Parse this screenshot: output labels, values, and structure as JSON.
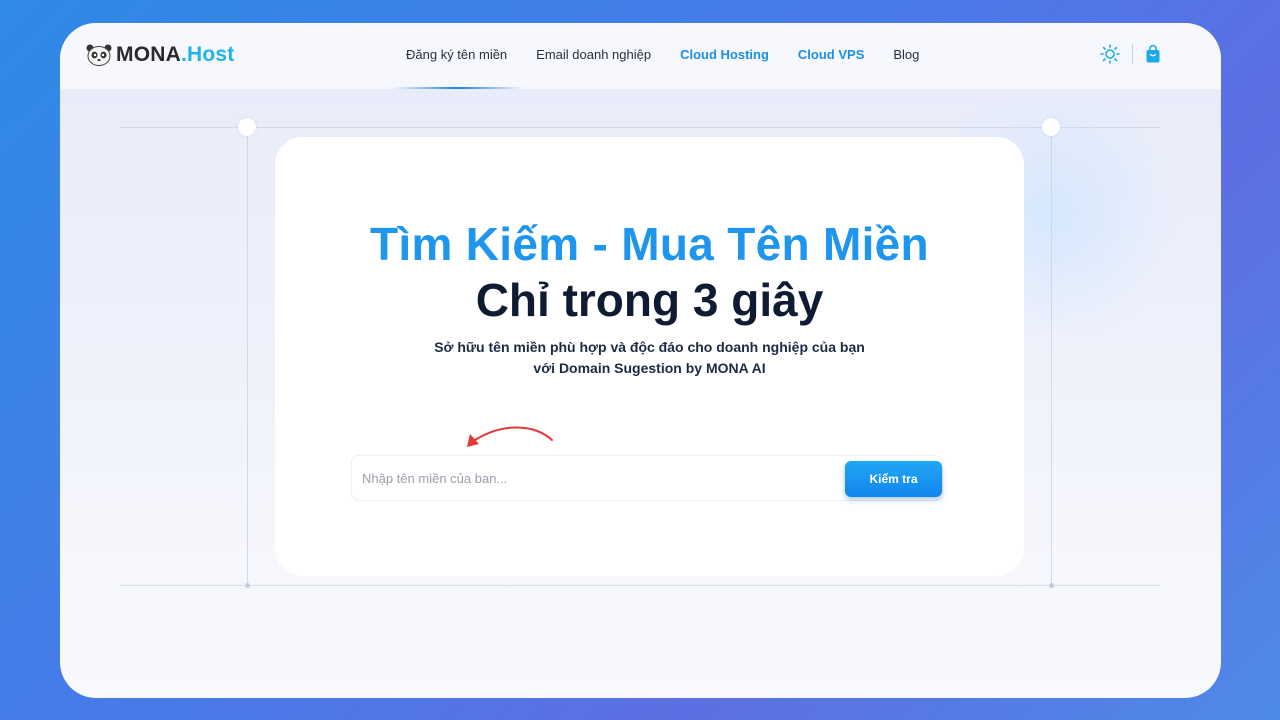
{
  "brand": {
    "name_main": "MONA",
    "name_accent": ".Host",
    "accent_color": "#1fb3ee"
  },
  "nav": {
    "items": [
      {
        "label": "Đăng ký tên miền",
        "highlighted": false
      },
      {
        "label": "Email doanh nghiệp",
        "highlighted": false
      },
      {
        "label": "Cloud Hosting",
        "highlighted": true
      },
      {
        "label": "Cloud VPS",
        "highlighted": true
      },
      {
        "label": "Blog",
        "highlighted": false
      }
    ],
    "active_index": 0
  },
  "header_icons": {
    "theme_toggle": "sun-icon",
    "cart": "shopping-bag-icon"
  },
  "hero": {
    "title_line1": "Tìm Kiếm - Mua Tên Miền",
    "title_line2": "Chỉ trong 3 giây",
    "subtitle": "Sở hữu tên miền phù hợp và độc đáo cho doanh nghiệp của bạn với Domain Sugestion by MONA AI"
  },
  "search": {
    "placeholder": "Nhập tên miền của ban...",
    "value": "",
    "button_label": "Kiểm tra"
  },
  "annotation": {
    "icon": "curved-arrow-icon",
    "color": "#e53935"
  },
  "colors": {
    "primary": "#1e96ee",
    "heading_dark": "#0f1b33"
  }
}
